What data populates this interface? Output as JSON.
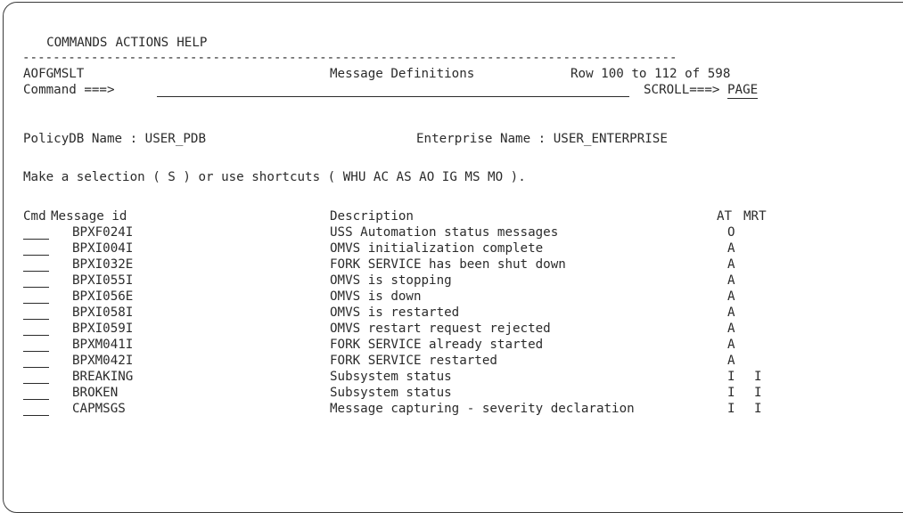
{
  "menu": {
    "items": [
      "COMMANDS",
      "ACTIONS",
      "HELP"
    ]
  },
  "divider": "--------------------------------------------------------------------------------------",
  "header": {
    "panel_id": "AOFGMSLT",
    "title": "Message Definitions",
    "row_info": "Row 100 to 112 of 598",
    "command_label": "Command ===>",
    "command_value": "",
    "scroll_label": "SCROLL===>",
    "scroll_value": "PAGE"
  },
  "info": {
    "policydb_label": "PolicyDB Name : USER_PDB",
    "enterprise_label": "Enterprise Name : USER_ENTERPRISE",
    "instruction": "Make a selection ( S ) or use shortcuts ( WHU AC AS AO IG MS MO )."
  },
  "table": {
    "headers": {
      "cmd": "Cmd",
      "msgid": "Message id",
      "desc": "Description",
      "at": "AT",
      "mrt": "MRT"
    },
    "rows": [
      {
        "msgid": "BPXF024I",
        "desc": "USS Automation status messages",
        "at": "O",
        "mrt": ""
      },
      {
        "msgid": "BPXI004I",
        "desc": "OMVS initialization complete",
        "at": "A",
        "mrt": ""
      },
      {
        "msgid": "BPXI032E",
        "desc": "FORK SERVICE has been shut down",
        "at": "A",
        "mrt": ""
      },
      {
        "msgid": "BPXI055I",
        "desc": "OMVS is stopping",
        "at": "A",
        "mrt": ""
      },
      {
        "msgid": "BPXI056E",
        "desc": "OMVS is down",
        "at": "A",
        "mrt": ""
      },
      {
        "msgid": "BPXI058I",
        "desc": "OMVS is restarted",
        "at": "A",
        "mrt": ""
      },
      {
        "msgid": "BPXI059I",
        "desc": "OMVS restart request rejected",
        "at": "A",
        "mrt": ""
      },
      {
        "msgid": "BPXM041I",
        "desc": "FORK SERVICE already started",
        "at": "A",
        "mrt": ""
      },
      {
        "msgid": "BPXM042I",
        "desc": "FORK SERVICE restarted",
        "at": "A",
        "mrt": ""
      },
      {
        "msgid": "BREAKING",
        "desc": "Subsystem status",
        "at": "I",
        "mrt": "I"
      },
      {
        "msgid": "BROKEN",
        "desc": "Subsystem status",
        "at": "I",
        "mrt": "I"
      },
      {
        "msgid": "CAPMSGS",
        "desc": "Message capturing - severity declaration",
        "at": "I",
        "mrt": "I"
      }
    ]
  }
}
